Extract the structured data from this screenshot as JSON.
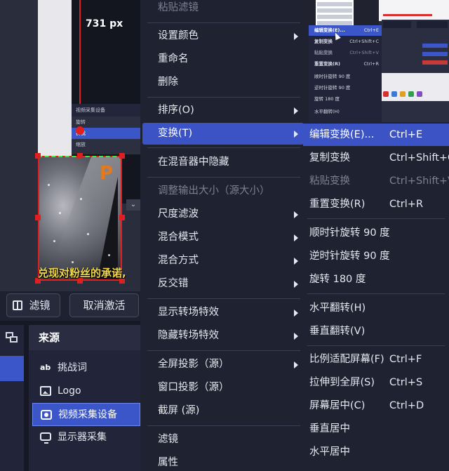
{
  "preview": {
    "measure_label": "731 px",
    "subtitle": "兑现对粉丝的承诺,",
    "mini_panel": {
      "title": "视频采集设备",
      "rows": [
        "旋转",
        "挤我",
        "缩放"
      ]
    },
    "mark": "P"
  },
  "toolbar": {
    "filter_label": "滤镜",
    "deactivate_label": "取消激活"
  },
  "sources": {
    "title": "来源",
    "items": [
      {
        "icon": "text-icon",
        "glyph": "ab",
        "label": "挑战词",
        "selected": false
      },
      {
        "icon": "image-icon",
        "label": "Logo",
        "selected": false
      },
      {
        "icon": "camera-icon",
        "label": "视频采集设备",
        "selected": true
      },
      {
        "icon": "monitor-icon",
        "label": "显示器采集",
        "selected": false
      }
    ]
  },
  "menu": {
    "items": [
      {
        "label": "粘贴滤镜",
        "disabled": true
      },
      {
        "label": "设置颜色",
        "submenu": true
      },
      {
        "label": "重命名"
      },
      {
        "label": "删除"
      },
      {
        "label": "排序(O)",
        "submenu": true
      },
      {
        "label": "变换(T)",
        "submenu": true,
        "highlighted": true
      },
      {
        "label": "在混音器中隐藏"
      },
      {
        "label": "调整输出大小（源大小）",
        "disabled": true
      },
      {
        "label": "尺度滤波",
        "submenu": true
      },
      {
        "label": "混合模式",
        "submenu": true
      },
      {
        "label": "混合方式",
        "submenu": true
      },
      {
        "label": "反交错",
        "submenu": true
      },
      {
        "label": "显示转场特效",
        "submenu": true
      },
      {
        "label": "隐藏转场特效",
        "submenu": true
      },
      {
        "label": "全屏投影（源）",
        "submenu": true
      },
      {
        "label": "窗口投影（源）"
      },
      {
        "label": "截屏 (源)"
      },
      {
        "label": "滤镜"
      },
      {
        "label": "属性"
      }
    ]
  },
  "thumbnail": {
    "rows": [
      {
        "label": "编辑变换(E)...",
        "shortcut": "Ctrl+E",
        "selected": true
      },
      {
        "label": "复制变换",
        "shortcut": "Ctrl+Shift+C"
      },
      {
        "label": "粘贴变换",
        "shortcut": "Ctrl+Shift+V"
      },
      {
        "label": "重置变换(R)",
        "shortcut": "Ctrl+R"
      },
      {
        "label": "顺时针旋转 90 度",
        "shortcut": ""
      },
      {
        "label": "逆时针旋转 90 度",
        "shortcut": ""
      },
      {
        "label": "旋转 180 度",
        "shortcut": ""
      },
      {
        "label": "水平翻转(H)",
        "shortcut": ""
      }
    ]
  },
  "submenu": {
    "items": [
      {
        "label": "编辑变换(E)...",
        "shortcut": "Ctrl+E",
        "highlighted": true
      },
      {
        "label": "复制变换",
        "shortcut": "Ctrl+Shift+C"
      },
      {
        "label": "粘贴变换",
        "shortcut": "Ctrl+Shift+V",
        "disabled": true
      },
      {
        "label": "重置变换(R)",
        "shortcut": "Ctrl+R"
      },
      {
        "label": "顺时针旋转 90 度",
        "shortcut": ""
      },
      {
        "label": "逆时针旋转 90 度",
        "shortcut": ""
      },
      {
        "label": "旋转 180 度",
        "shortcut": ""
      },
      {
        "label": "水平翻转(H)",
        "shortcut": ""
      },
      {
        "label": "垂直翻转(V)",
        "shortcut": ""
      },
      {
        "label": "比例适配屏幕(F)",
        "shortcut": "Ctrl+F"
      },
      {
        "label": "拉伸到全屏(S)",
        "shortcut": "Ctrl+S"
      },
      {
        "label": "屏幕居中(C)",
        "shortcut": "Ctrl+D"
      },
      {
        "label": "垂直居中",
        "shortcut": ""
      },
      {
        "label": "水平居中",
        "shortcut": ""
      }
    ]
  },
  "colors": {
    "accent": "#3b53c4",
    "menu_bg": "#1f2231",
    "selection_border": "#e02020",
    "guide": "#3fe83f"
  }
}
